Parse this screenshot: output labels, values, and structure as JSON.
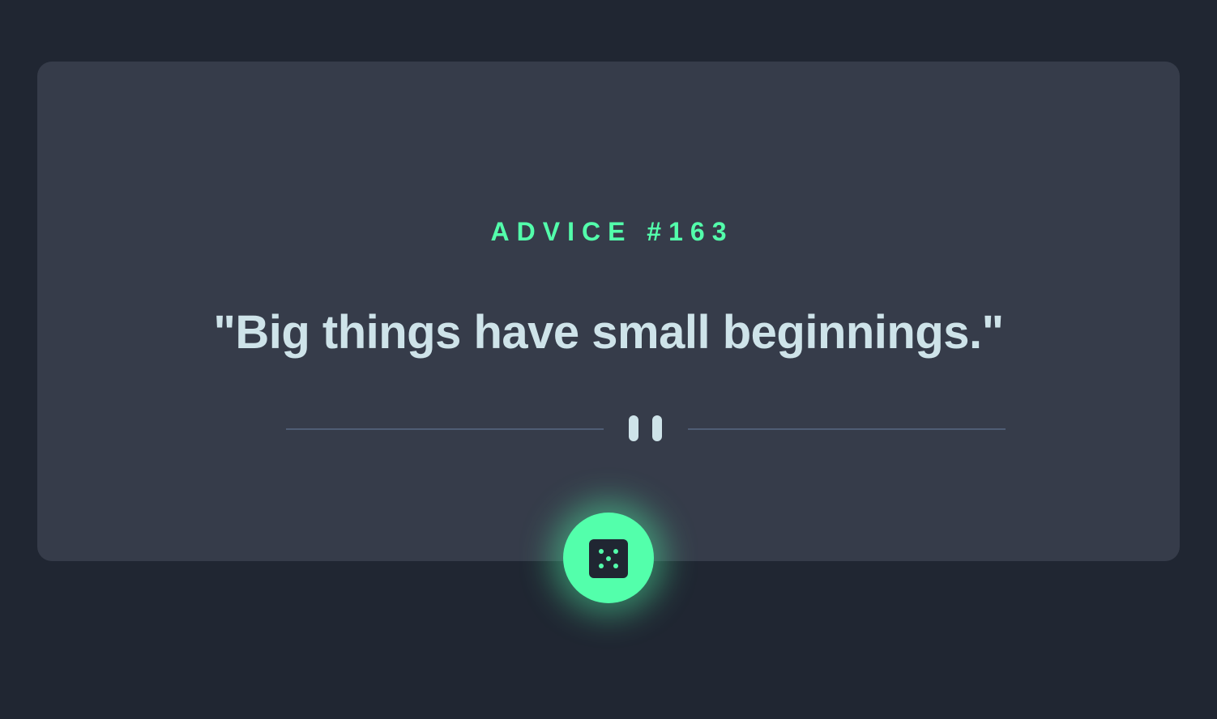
{
  "advice": {
    "label": "ADVICE #163",
    "text": "\"Big things have small beginnings.\""
  },
  "icons": {
    "divider": "pause-icon",
    "button": "dice-icon"
  },
  "colors": {
    "background": "#202632",
    "card": "#363c4a",
    "accent": "#53ffab",
    "text": "#cee3e9",
    "divider": "#4f5d74"
  }
}
